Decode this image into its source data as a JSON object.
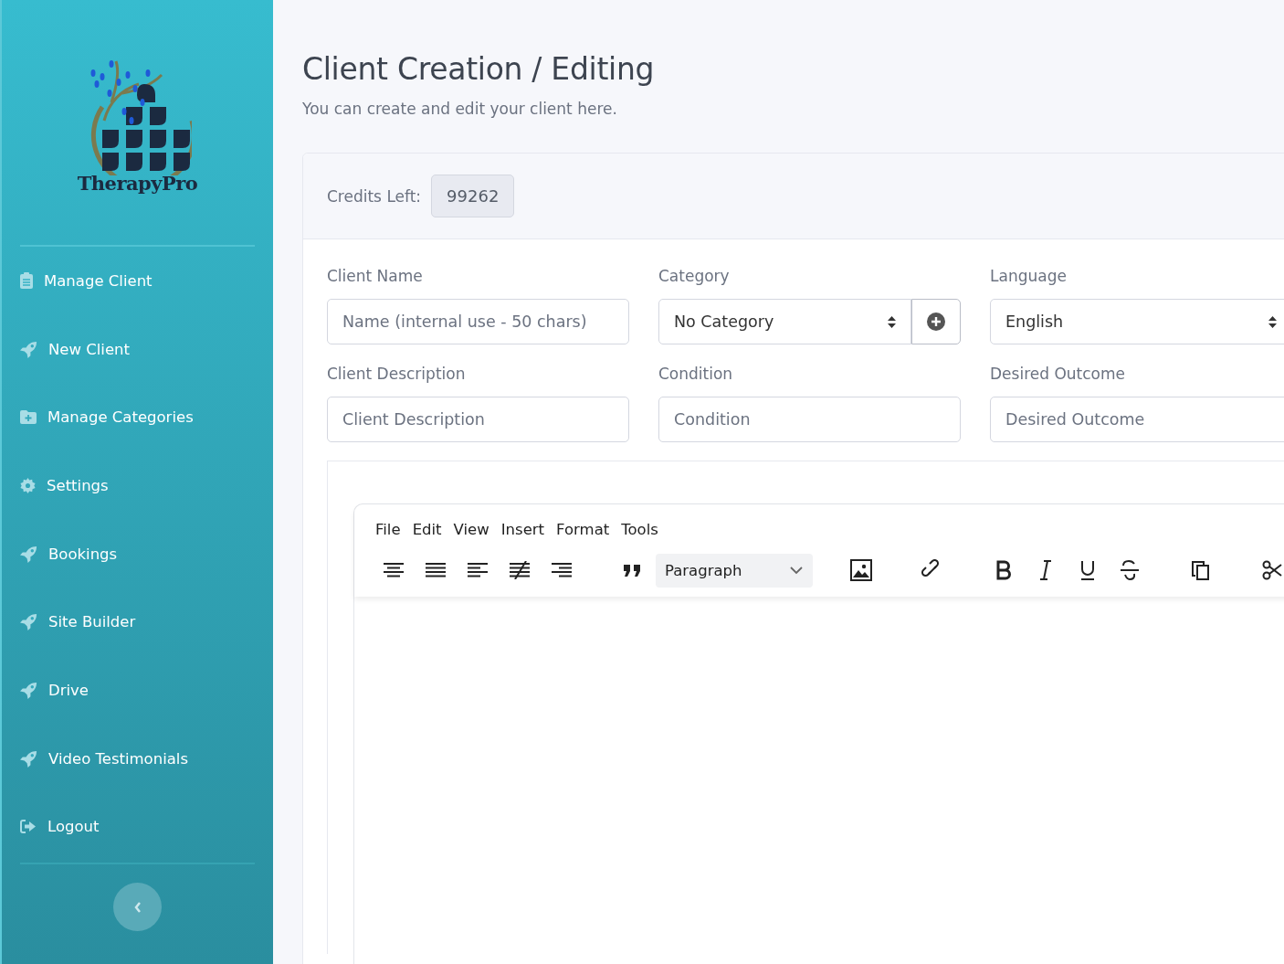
{
  "sidebar": {
    "logo_text": "TherapyPro",
    "items": [
      {
        "label": "Manage Client",
        "kind": "clipboard"
      },
      {
        "label": "New Client",
        "kind": "rocket"
      },
      {
        "label": "Manage Categories",
        "kind": "folder"
      },
      {
        "label": "Settings",
        "kind": "gear"
      },
      {
        "label": "Bookings",
        "kind": "rocket"
      },
      {
        "label": "Site Builder",
        "kind": "rocket"
      },
      {
        "label": "Drive",
        "kind": "rocket"
      },
      {
        "label": "Video Testimonials",
        "kind": "rocket"
      },
      {
        "label": "Logout",
        "kind": "logout"
      }
    ]
  },
  "page": {
    "title": "Client Creation / Editing",
    "subtitle": "You can create and edit your client here."
  },
  "credits": {
    "label": "Credits Left:",
    "value": "99262"
  },
  "fields": [
    {
      "label": "Client Name",
      "kind": "text",
      "placeholder": "Name (internal use - 50 chars)"
    },
    {
      "label": "Category",
      "kind": "select_add",
      "value": "No Category"
    },
    {
      "label": "Language",
      "kind": "select",
      "value": "English"
    },
    {
      "label": "Client Description",
      "kind": "text",
      "placeholder": "Client Description"
    },
    {
      "label": "Condition",
      "kind": "text",
      "placeholder": "Condition"
    },
    {
      "label": "Desired Outcome",
      "kind": "text",
      "placeholder": "Desired Outcome"
    }
  ],
  "editor": {
    "menu": [
      "File",
      "Edit",
      "View",
      "Insert",
      "Format",
      "Tools"
    ],
    "block_format": "Paragraph"
  }
}
